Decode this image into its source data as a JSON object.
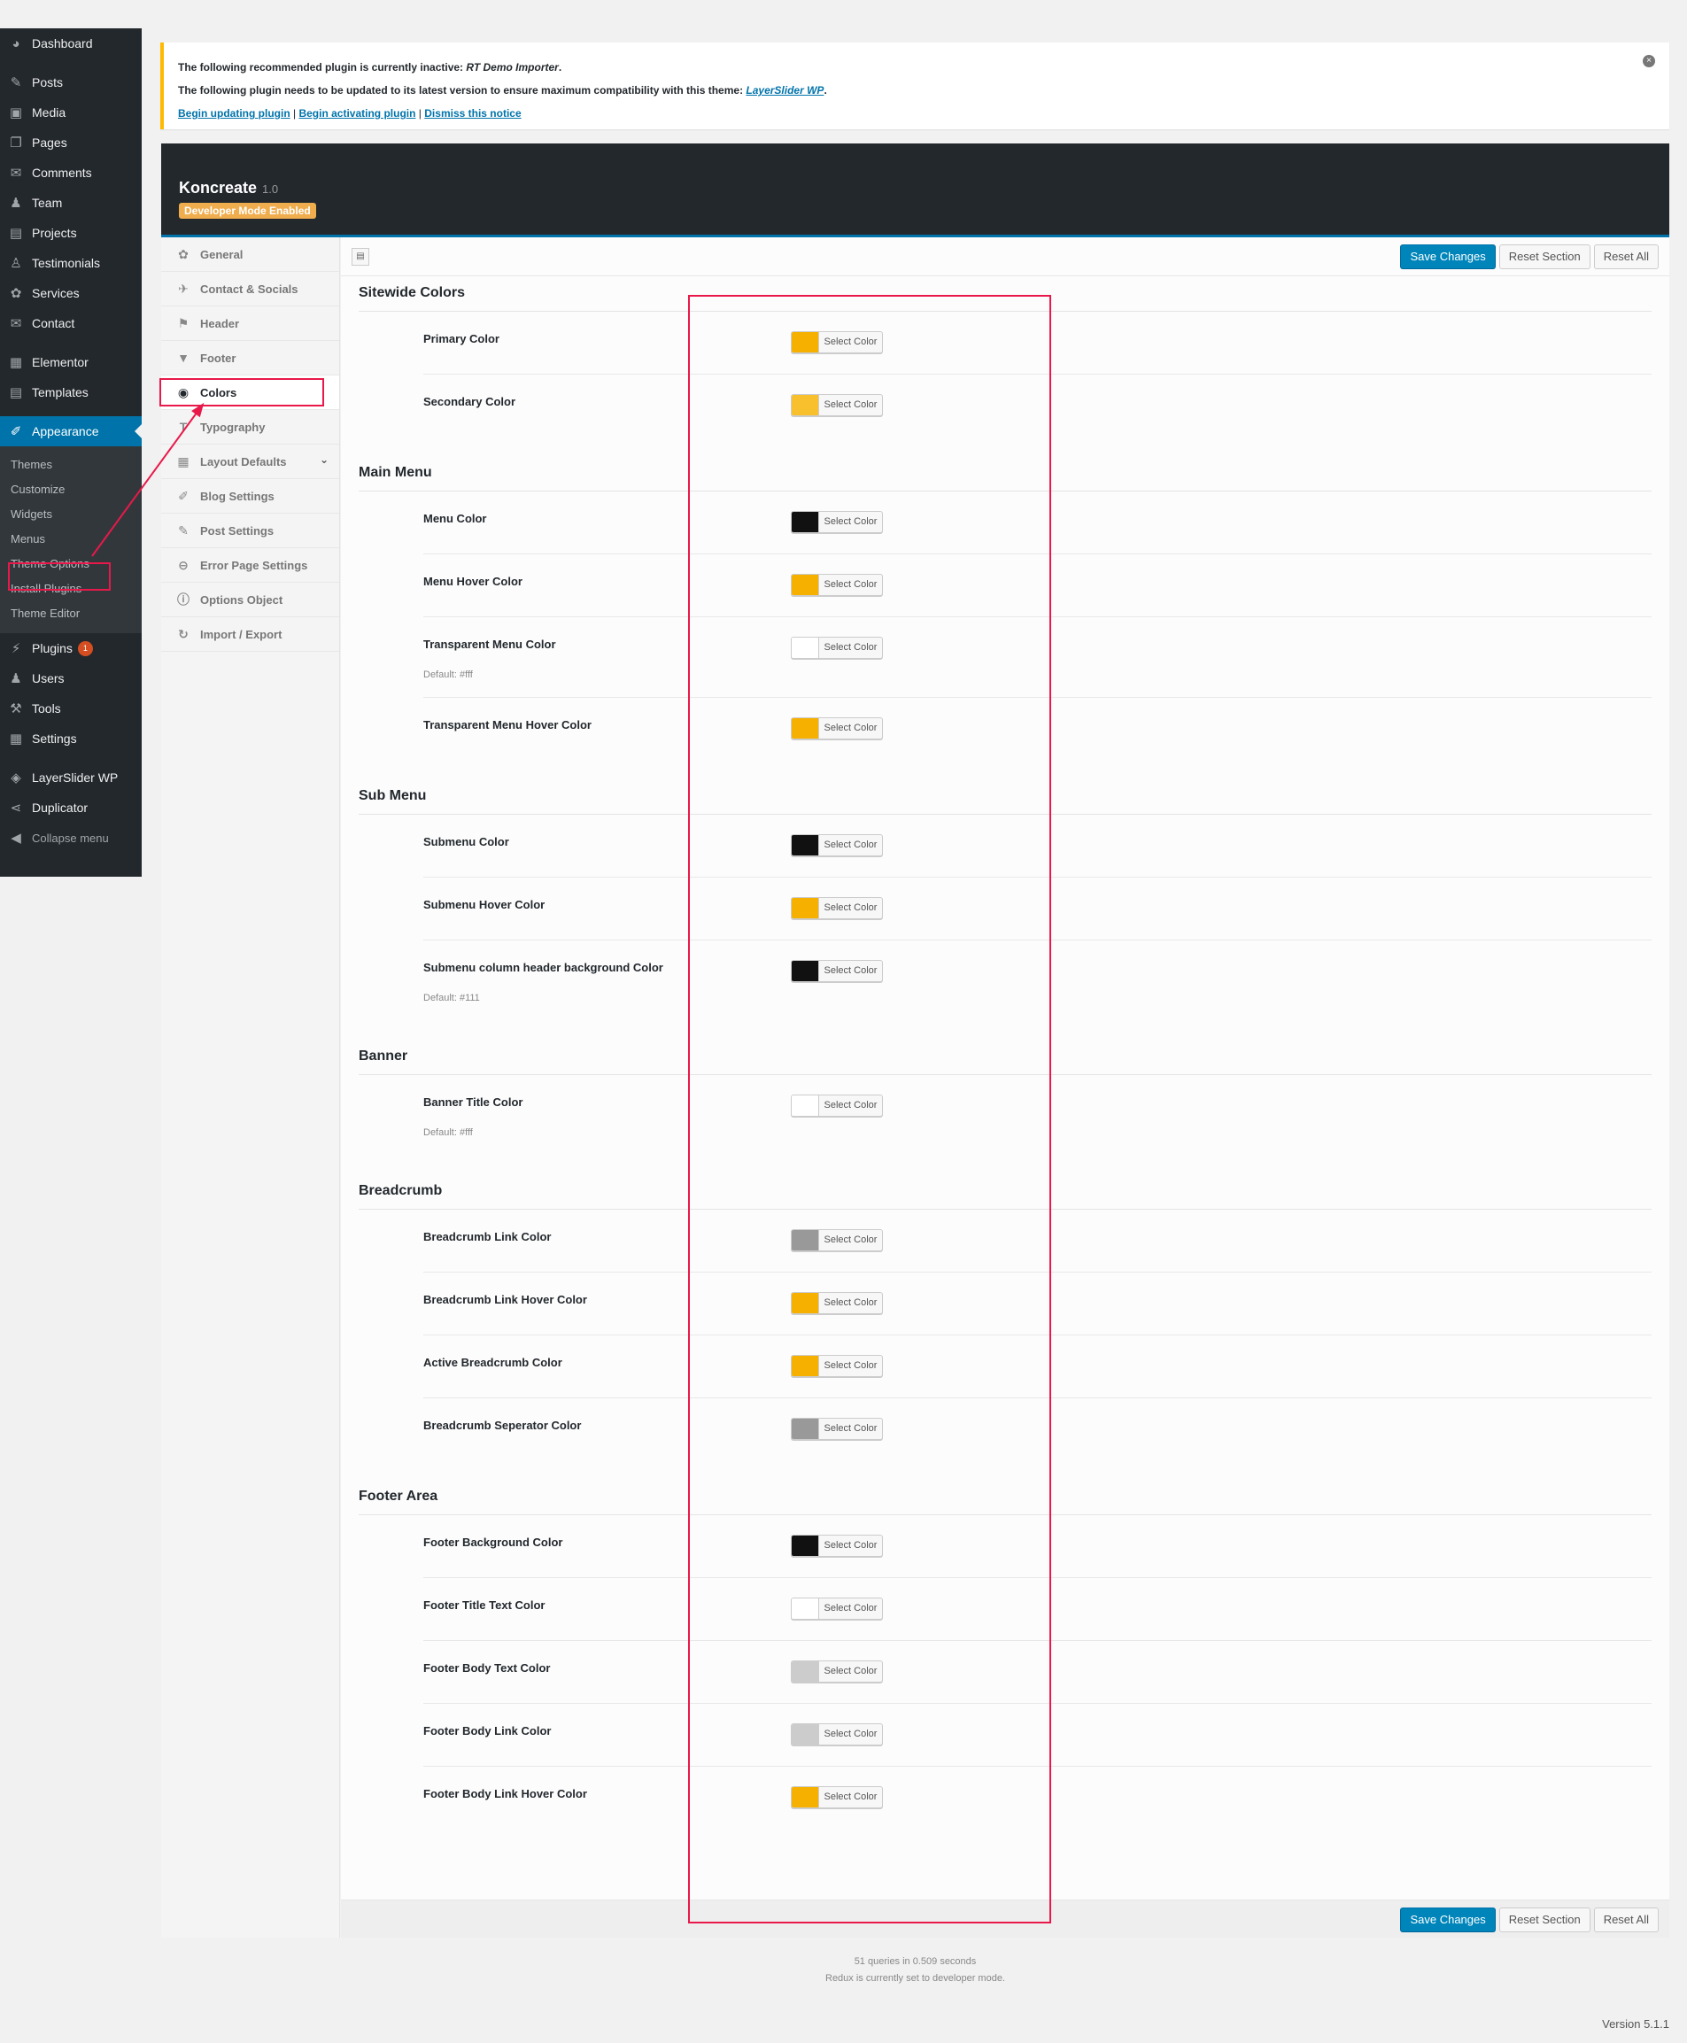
{
  "admin_menu": {
    "top": [
      {
        "label": "Dashboard",
        "icon": "dashboard-icon",
        "glyph": "◕"
      },
      {
        "sep": true
      },
      {
        "label": "Posts",
        "icon": "pin-icon",
        "glyph": "✎"
      },
      {
        "label": "Media",
        "icon": "media-icon",
        "glyph": "▣"
      },
      {
        "label": "Pages",
        "icon": "pages-icon",
        "glyph": "❐"
      },
      {
        "label": "Comments",
        "icon": "comment-icon",
        "glyph": "✉"
      },
      {
        "label": "Team",
        "icon": "team-icon",
        "glyph": "♟"
      },
      {
        "label": "Projects",
        "icon": "folder-icon",
        "glyph": "▤"
      },
      {
        "label": "Testimonials",
        "icon": "testimonial-icon",
        "glyph": "♙"
      },
      {
        "label": "Services",
        "icon": "services-icon",
        "glyph": "✿"
      },
      {
        "label": "Contact",
        "icon": "mail-icon",
        "glyph": "✉"
      },
      {
        "sep": true
      },
      {
        "label": "Elementor",
        "icon": "elementor-icon",
        "glyph": "▦"
      },
      {
        "label": "Templates",
        "icon": "templates-icon",
        "glyph": "▤"
      },
      {
        "sep": true
      },
      {
        "label": "Appearance",
        "icon": "brush-icon",
        "glyph": "✐",
        "current": true
      }
    ],
    "appearance_submenu": [
      "Themes",
      "Customize",
      "Widgets",
      "Menus",
      "Theme Options",
      "Install Plugins",
      "Theme Editor"
    ],
    "bottom": [
      {
        "label": "Plugins",
        "icon": "plugins-icon",
        "glyph": "⚡",
        "badge": "1"
      },
      {
        "label": "Users",
        "icon": "users-icon",
        "glyph": "♟"
      },
      {
        "label": "Tools",
        "icon": "tools-icon",
        "glyph": "⚒"
      },
      {
        "label": "Settings",
        "icon": "settings-icon",
        "glyph": "▦"
      },
      {
        "sep": true
      },
      {
        "label": "LayerSlider WP",
        "icon": "layerslider-icon",
        "glyph": "◈"
      },
      {
        "label": "Duplicator",
        "icon": "share-icon",
        "glyph": "⋖"
      }
    ],
    "collapse": {
      "label": "Collapse menu",
      "glyph": "◀"
    }
  },
  "notice": {
    "line1_prefix": "The following recommended plugin is currently inactive: ",
    "line1_plugin": "RT Demo Importer",
    "line1_suffix": ".",
    "line2_prefix": "The following plugin needs to be updated to its latest version to ensure maximum compatibility with this theme: ",
    "line2_plugin": "LayerSlider WP",
    "line2_suffix": ".",
    "link_update": "Begin updating plugin",
    "link_activate": "Begin activating plugin",
    "link_dismiss": "Dismiss this notice",
    "separator": " | "
  },
  "redux_header": {
    "title": "Koncreate",
    "version": "1.0",
    "dev_badge": "Developer Mode Enabled"
  },
  "redux_nav": [
    {
      "label": "General",
      "icon": "gear-globe-icon",
      "glyph": "✿"
    },
    {
      "label": "Contact & Socials",
      "icon": "twitter-icon",
      "glyph": "✈"
    },
    {
      "label": "Header",
      "icon": "flag-icon",
      "glyph": "⚑"
    },
    {
      "label": "Footer",
      "icon": "funnel-icon",
      "glyph": "▼"
    },
    {
      "label": "Colors",
      "icon": "eye-icon",
      "glyph": "◉",
      "active": true
    },
    {
      "label": "Typography",
      "icon": "text-icon",
      "glyph": "T"
    },
    {
      "label": "Layout Defaults",
      "icon": "grid-icon",
      "glyph": "▦",
      "has_children": true
    },
    {
      "label": "Blog Settings",
      "icon": "tags-icon",
      "glyph": "✐"
    },
    {
      "label": "Post Settings",
      "icon": "edit-icon",
      "glyph": "✎"
    },
    {
      "label": "Error Page Settings",
      "icon": "minus-circle-icon",
      "glyph": "⊖"
    },
    {
      "label": "Options Object",
      "icon": "info-icon",
      "glyph": "ⓘ"
    },
    {
      "label": "Import / Export",
      "icon": "refresh-icon",
      "glyph": "↻"
    }
  ],
  "buttons": {
    "save": "Save Changes",
    "reset_section": "Reset Section",
    "reset_all": "Reset All"
  },
  "picker_label": "Select Color",
  "sections": [
    {
      "title": "Sitewide Colors",
      "fields": [
        {
          "label": "Primary Color",
          "color": "#f5b000"
        },
        {
          "label": "Secondary Color",
          "color": "#f7c02c"
        }
      ]
    },
    {
      "title": "Main Menu",
      "fields": [
        {
          "label": "Menu Color",
          "color": "#111111"
        },
        {
          "label": "Menu Hover Color",
          "color": "#f5b000"
        },
        {
          "label": "Transparent Menu Color",
          "color": "#ffffff",
          "default": "Default: #fff"
        },
        {
          "label": "Transparent Menu Hover Color",
          "color": "#f5b000"
        }
      ]
    },
    {
      "title": "Sub Menu",
      "fields": [
        {
          "label": "Submenu Color",
          "color": "#111111"
        },
        {
          "label": "Submenu Hover Color",
          "color": "#f5b000"
        },
        {
          "label": "Submenu column header background Color",
          "color": "#111111",
          "default": "Default: #111"
        }
      ]
    },
    {
      "title": "Banner",
      "fields": [
        {
          "label": "Banner Title Color",
          "color": "#ffffff",
          "default": "Default: #fff"
        }
      ]
    },
    {
      "title": "Breadcrumb",
      "fields": [
        {
          "label": "Breadcrumb Link Color",
          "color": "#999999"
        },
        {
          "label": "Breadcrumb Link Hover Color",
          "color": "#f5b000"
        },
        {
          "label": "Active Breadcrumb Color",
          "color": "#f5b000"
        },
        {
          "label": "Breadcrumb Seperator Color",
          "color": "#999999"
        }
      ]
    },
    {
      "title": "Footer Area",
      "fields": [
        {
          "label": "Footer Background Color",
          "color": "#111111"
        },
        {
          "label": "Footer Title Text Color",
          "color": "#ffffff"
        },
        {
          "label": "Footer Body Text Color",
          "color": "#cccccc"
        },
        {
          "label": "Footer Body Link Color",
          "color": "#cccccc"
        },
        {
          "label": "Footer Body Link Hover Color",
          "color": "#f5b000"
        }
      ]
    }
  ],
  "footer_info": {
    "queries": "51 queries in 0.509 seconds",
    "devmode": "Redux is currently set to developer mode."
  },
  "wp_version": "Version 5.1.1",
  "annotation_color": "#e8194a"
}
